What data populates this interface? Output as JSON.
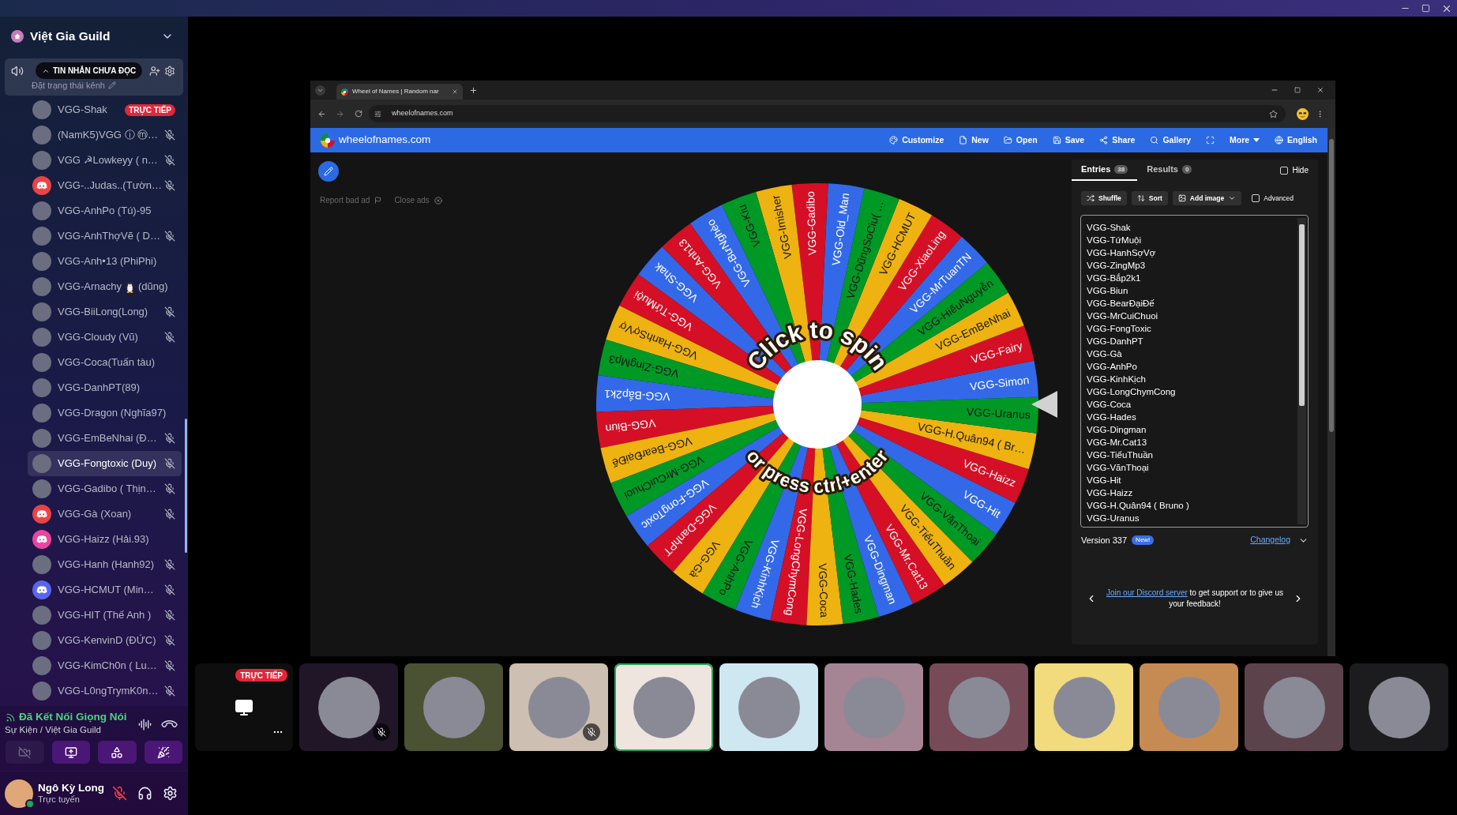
{
  "server": {
    "name": "Việt Gia Guild"
  },
  "channel": {
    "unread_pill": "TIN NHẮN CHƯA ĐỌC",
    "status_hint": "Đặt trạng thái kênh"
  },
  "members": [
    {
      "name": "VGG-Shak",
      "avatar": {
        "kind": "photo"
      },
      "badge": "TRỰC TIẾP",
      "muted": false,
      "selected": false
    },
    {
      "name": "(NamK5)VGG ⓘ ⓜ…",
      "avatar": {
        "kind": "photo"
      },
      "muted": true,
      "selected": false
    },
    {
      "name": "VGG ☭Lowkeyy ( n…",
      "avatar": {
        "kind": "photo"
      },
      "muted": true,
      "selected": false
    },
    {
      "name": "VGG-..Judas..(Tườn…",
      "avatar": {
        "kind": "default",
        "color": "#ed4245"
      },
      "muted": true,
      "selected": false
    },
    {
      "name": "VGG-AnhPo (Tú)-95",
      "avatar": {
        "kind": "photo"
      },
      "muted": false,
      "selected": false
    },
    {
      "name": "VGG-AnhThợVẽ ( D…",
      "avatar": {
        "kind": "photo"
      },
      "muted": true,
      "selected": false
    },
    {
      "name": "VGG-Anh•13 (PhiPhi)",
      "avatar": {
        "kind": "photo"
      },
      "muted": false,
      "selected": false
    },
    {
      "name": "VGG-Arnachy",
      "name_tail": "(dũng)",
      "avatar": {
        "kind": "photo"
      },
      "muted": false,
      "selected": false
    },
    {
      "name": "VGG-BiiLong(Long)",
      "avatar": {
        "kind": "photo"
      },
      "muted": true,
      "selected": false
    },
    {
      "name": "VGG-Cloudy (Vũ)",
      "avatar": {
        "kind": "photo"
      },
      "muted": true,
      "selected": false
    },
    {
      "name": "VGG-Coca(Tuấn tàu)",
      "avatar": {
        "kind": "photo"
      },
      "muted": false,
      "selected": false
    },
    {
      "name": "VGG-DanhPT(89)",
      "avatar": {
        "kind": "photo"
      },
      "muted": false,
      "selected": false
    },
    {
      "name": "VGG-Dragon (Nghĩa97)",
      "avatar": {
        "kind": "photo"
      },
      "muted": false,
      "selected": false
    },
    {
      "name": "VGG-EmBeNhai (Đ…",
      "avatar": {
        "kind": "photo"
      },
      "muted": true,
      "selected": false
    },
    {
      "name": "VGG-Fongtoxic (Duy)",
      "avatar": {
        "kind": "photo"
      },
      "muted": true,
      "selected": true
    },
    {
      "name": "VGG-Gadibo ( Thịn…",
      "avatar": {
        "kind": "photo"
      },
      "muted": true,
      "selected": false
    },
    {
      "name": "VGG-Gà (Xoan)",
      "avatar": {
        "kind": "default",
        "color": "#ed4245"
      },
      "muted": true,
      "selected": false
    },
    {
      "name": "VGG-Haizz (Hải.93)",
      "avatar": {
        "kind": "default",
        "color": "#eb459f"
      },
      "muted": false,
      "selected": false
    },
    {
      "name": "VGG-Hanh (Hanh92)",
      "avatar": {
        "kind": "photo"
      },
      "muted": true,
      "selected": false
    },
    {
      "name": "VGG-HCMUT (Min…",
      "avatar": {
        "kind": "default",
        "color": "#5865f2"
      },
      "muted": true,
      "selected": false
    },
    {
      "name": "VGG-HIT (Thế Anh )",
      "avatar": {
        "kind": "photo"
      },
      "muted": true,
      "selected": false
    },
    {
      "name": "VGG-KenvinD (ĐỨC)",
      "avatar": {
        "kind": "photo"
      },
      "muted": true,
      "selected": false
    },
    {
      "name": "VGG-KimCh0n ( Lu…",
      "avatar": {
        "kind": "photo"
      },
      "muted": true,
      "selected": false
    },
    {
      "name": "VGG-L0ngTrymK0n…",
      "avatar": {
        "kind": "photo"
      },
      "muted": true,
      "selected": false
    }
  ],
  "voice": {
    "status": "Đã Kết Nối Giọng Nói",
    "location": "Sự Kiện / Việt Gia Guild",
    "buttons": [
      {
        "kind": "camera",
        "disabled": true
      },
      {
        "kind": "screen_share",
        "disabled": false
      },
      {
        "kind": "activities",
        "disabled": false
      },
      {
        "kind": "soundboard",
        "disabled": false
      }
    ]
  },
  "user": {
    "name": "Ngô Kỳ Long",
    "status": "Trực tuyến",
    "mic_muted": true
  },
  "browser": {
    "tab_title": "Wheel of Names | Random nar",
    "url": "wheelofnames.com"
  },
  "site": {
    "brand": "wheelofnames.com",
    "menu": [
      {
        "kind": "customize",
        "label": "Customize"
      },
      {
        "kind": "new",
        "label": "New"
      },
      {
        "kind": "open",
        "label": "Open"
      },
      {
        "kind": "save",
        "label": "Save"
      },
      {
        "kind": "share",
        "label": "Share"
      },
      {
        "kind": "gallery",
        "label": "Gallery"
      },
      {
        "kind": "fullscreen"
      },
      {
        "kind": "more",
        "label": "More"
      },
      {
        "kind": "language",
        "label": "English"
      }
    ],
    "ad_links": [
      "Report bad ad",
      "Close ads"
    ]
  },
  "wheel": {
    "hint_top": "Click to spin",
    "hint_bottom": "or press ctrl+enter",
    "segments": [
      "VGG-Shak",
      "VGG-TứMuội",
      "VGG-HanhSợVợ",
      "VGG-ZingMp3",
      "VGG-Bắp2k1",
      "VGG-Biun",
      "VGG-BearĐạiĐế",
      "VGG-MrCuiChuoi",
      "VGG-FongToxic",
      "VGG-DanhPT",
      "VGG-Gà",
      "VGG-AnhPo",
      "VGG-KinhKịch",
      "VGG-LongChymCong",
      "VGG-Coca",
      "VGG-Hades",
      "VGG-Dingman",
      "VGG-Mr.Cat13",
      "VGG-TiểuThuần",
      "VGG-VănThoại",
      "VGG-Hit",
      "VGG-Haizz",
      "VGG-H.Quân94 ( Br…",
      "VGG-Uranus",
      "VGG-Simon",
      "VGG-Fairy",
      "VGG-EmBeNhai",
      "VGG-HiếuNguyễn",
      "VGG-MrTuanTN",
      "VGG-XiaoLing",
      "VGG-HCMUT",
      "VGG-DũngSoCiu( …",
      "VGG-Old_Man",
      "VGG-Gadibo",
      "VGG-Imisher",
      "VGG-Kiu",
      "VGG-BưNghèo",
      "VGG-Anh13"
    ]
  },
  "entries_panel": {
    "tabs": [
      {
        "label": "Entries",
        "count": "38",
        "selected": true
      },
      {
        "label": "Results",
        "count": "0",
        "selected": false
      }
    ],
    "hide": {
      "label": "Hide",
      "checked": false
    },
    "actions": [
      {
        "kind": "shuffle",
        "label": "Shuffle"
      },
      {
        "kind": "sort",
        "label": "Sort"
      },
      {
        "kind": "add_image",
        "label": "Add image"
      }
    ],
    "advanced": {
      "label": "Advanced",
      "checked": false
    },
    "entries": [
      "VGG-Shak",
      "VGG-TứMuội",
      "VGG-HanhSợVợ",
      "VGG-ZingMp3",
      "VGG-Bắp2k1",
      "VGG-Biun",
      "VGG-BearĐạiĐế",
      "VGG-MrCuiChuoi",
      "VGG-FongToxic",
      "VGG-DanhPT",
      "VGG-Gà",
      "VGG-AnhPo",
      "VGG-KinhKịch",
      "VGG-LongChymCong",
      "VGG-Coca",
      "VGG-Hades",
      "VGG-Dingman",
      "VGG-Mr.Cat13",
      "VGG-TiểuThuần",
      "VGG-VănThoại",
      "VGG-Hit",
      "VGG-Haizz",
      "VGG-H.Quân94 ( Bruno )",
      "VGG-Uranus"
    ],
    "version": "Version 337",
    "version_badge": "New!",
    "changelog": "Changelog",
    "notice_link": "Join our Discord server",
    "notice_text": "to get support or to give us your feedback!"
  },
  "stage_tiles": [
    {
      "kind": "stream",
      "badge": "TRỰC TIẾP",
      "muted": false,
      "speaking": false
    },
    {
      "kind": "user",
      "color": "#201628",
      "muted": true,
      "speaking": false
    },
    {
      "kind": "user",
      "color": "#4b5233",
      "muted": false,
      "speaking": false
    },
    {
      "kind": "user",
      "color": "#cdbfb2",
      "muted": true,
      "speaking": false
    },
    {
      "kind": "user",
      "color": "#efe5df",
      "muted": false,
      "speaking": true
    },
    {
      "kind": "user",
      "color": "#cfe7f0",
      "muted": false,
      "speaking": false
    },
    {
      "kind": "user",
      "color": "#a58494",
      "muted": false,
      "speaking": false
    },
    {
      "kind": "user",
      "color": "#774a58",
      "muted": false,
      "speaking": false
    },
    {
      "kind": "user",
      "color": "#f1db7d",
      "muted": false,
      "speaking": false
    },
    {
      "kind": "user",
      "color": "#c68b52",
      "muted": false,
      "speaking": false
    },
    {
      "kind": "user",
      "color": "#5c434b",
      "muted": false,
      "speaking": false
    },
    {
      "kind": "user",
      "color": "#1c1c1e",
      "muted": false,
      "speaking": false
    }
  ]
}
